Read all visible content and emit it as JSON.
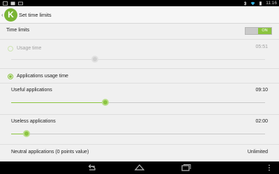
{
  "status_bar": {
    "time": "11:16",
    "left_icons": [
      "image-notification-icon",
      "photo-notification-icon",
      "message-notification-icon"
    ],
    "right_icons": [
      "bluetooth-icon",
      "wifi-icon",
      "battery-icon"
    ]
  },
  "action_bar": {
    "logo_letter": "K",
    "title": "Set time limits"
  },
  "time_limits": {
    "label": "Time limits",
    "toggle": "ON"
  },
  "usage_time": {
    "label": "Usage time",
    "value": "05:51",
    "slider_fraction": 0.33,
    "enabled": false
  },
  "applications_usage_time": {
    "label": "Applications usage time",
    "selected": true
  },
  "useful_applications": {
    "label": "Useful applications",
    "value": "09:10",
    "slider_fraction": 0.37
  },
  "useless_applications": {
    "label": "Useless applications",
    "value": "02:00",
    "slider_fraction": 0.06
  },
  "neutral_applications": {
    "label": "Neutral applications (0 points value)",
    "value": "Unlimited"
  },
  "colors": {
    "accent": "#8bc43f",
    "status_bar": "#000000",
    "background": "#f0f0f0"
  }
}
